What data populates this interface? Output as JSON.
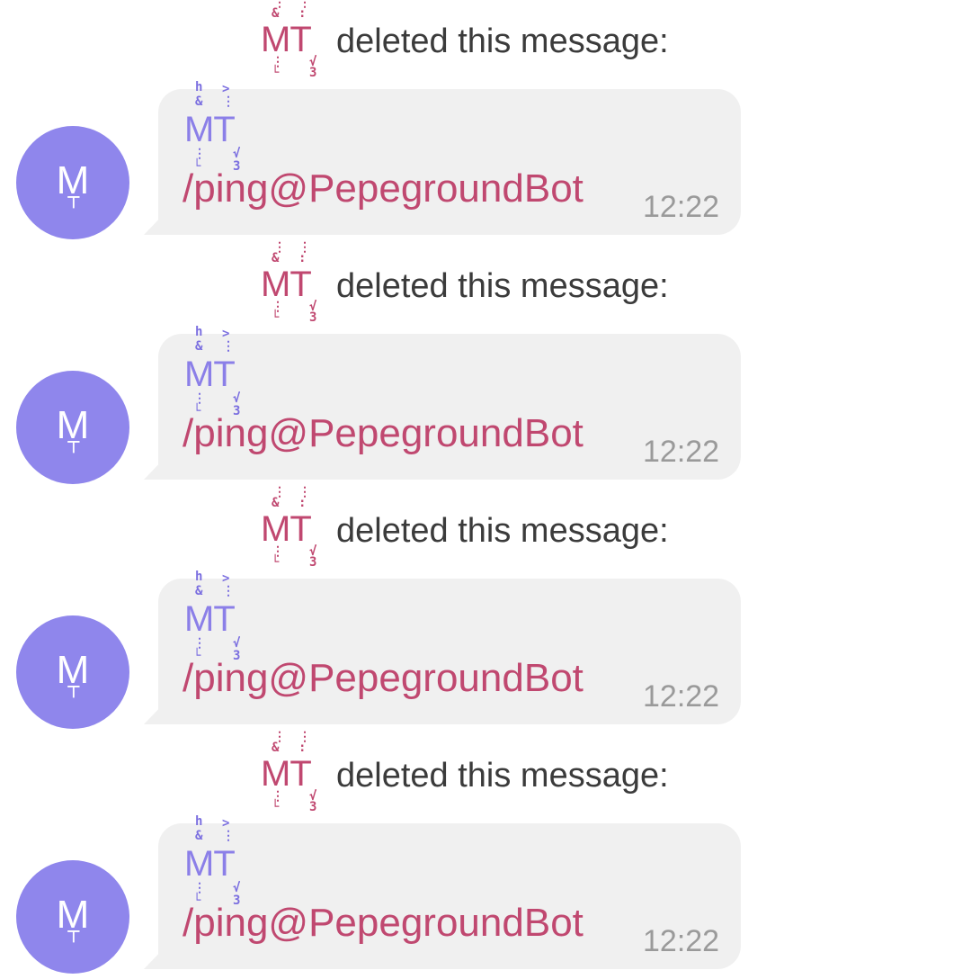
{
  "colors": {
    "avatar_bg": "#8f86ec",
    "bubble_bg": "#f0f0f0",
    "deleter_name": "#c04870",
    "sender_name": "#8b7fe8",
    "command": "#c04870",
    "timestamp": "#9a9a9a",
    "service_text": "#3b3b3b"
  },
  "messages": [
    {
      "deleter_name": "MT",
      "deleted_text": "deleted this message:",
      "avatar_letter": "M",
      "sender_name": "MT",
      "text": "/ping@PepegroundBot",
      "time": "12:22"
    },
    {
      "deleter_name": "MT",
      "deleted_text": "deleted this message:",
      "avatar_letter": "M",
      "sender_name": "MT",
      "text": "/ping@PepegroundBot",
      "time": "12:22"
    },
    {
      "deleter_name": "MT",
      "deleted_text": "deleted this message:",
      "avatar_letter": "M",
      "sender_name": "MT",
      "text": "/ping@PepegroundBot",
      "time": "12:22"
    },
    {
      "deleter_name": "MT",
      "deleted_text": "deleted this message:",
      "avatar_letter": "M",
      "sender_name": "MT",
      "text": "/ping@PepegroundBot",
      "time": "12:22"
    }
  ]
}
